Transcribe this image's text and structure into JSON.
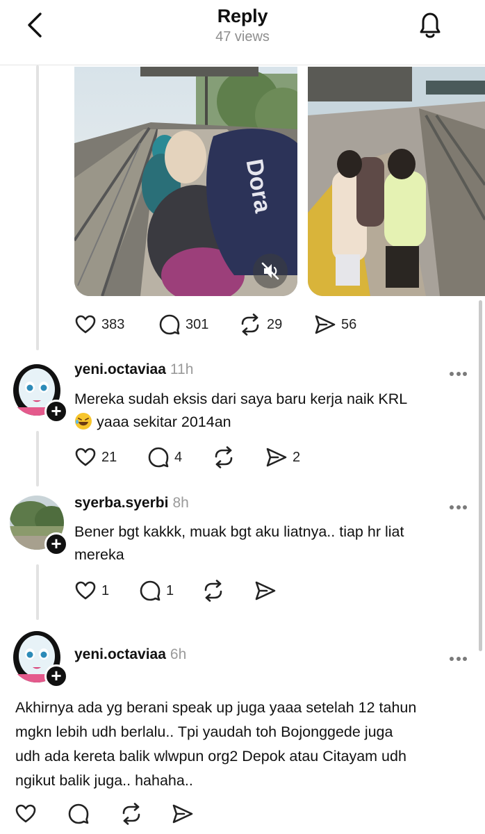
{
  "header": {
    "title": "Reply",
    "views": "47 views",
    "back_icon": "chevron-left-icon",
    "notification_icon": "bell-icon"
  },
  "post": {
    "media": [
      {
        "description_icon": "photo",
        "mute_icon": "speaker-muted-icon"
      },
      {
        "description_icon": "photo"
      }
    ],
    "actions": {
      "likes": "383",
      "comments": "301",
      "reposts": "29",
      "shares": "56"
    }
  },
  "replies": [
    {
      "username": "yeni.octaviaa",
      "time": "11h",
      "text_line1": "Mereka sudah eksis dari saya baru kerja naik KRL",
      "text_line2": "yaaa sekitar 2014an",
      "emoji": "rolling-on-the-floor-laughing",
      "likes": "21",
      "comments": "4",
      "reposts": "",
      "shares": "2"
    },
    {
      "username": "syerba.syerbi",
      "time": "8h",
      "text_line1": "Bener bgt kakkk, muak bgt aku liatnya.. tiap hr liat",
      "text_line2": "mereka",
      "likes": "1",
      "comments": "1",
      "reposts": "",
      "shares": ""
    },
    {
      "username": "yeni.octaviaa",
      "time": "6h",
      "text_line1": "Akhirnya ada yg berani speak up juga yaaa setelah 12 tahun",
      "text_line2": "mgkn lebih udh berlalu.. Tpi yaudah toh Bojonggede juga",
      "text_line3": "udh ada kereta balik wlwpun org2 Depok atau Citayam udh",
      "text_line4": "ngikut balik juga.. hahaha..",
      "likes": "",
      "comments": "",
      "reposts": "",
      "shares": ""
    }
  ],
  "colors": {
    "accent_text": "#101010",
    "muted_text": "#8e8e8e",
    "thread_line": "#e2e2e2"
  }
}
